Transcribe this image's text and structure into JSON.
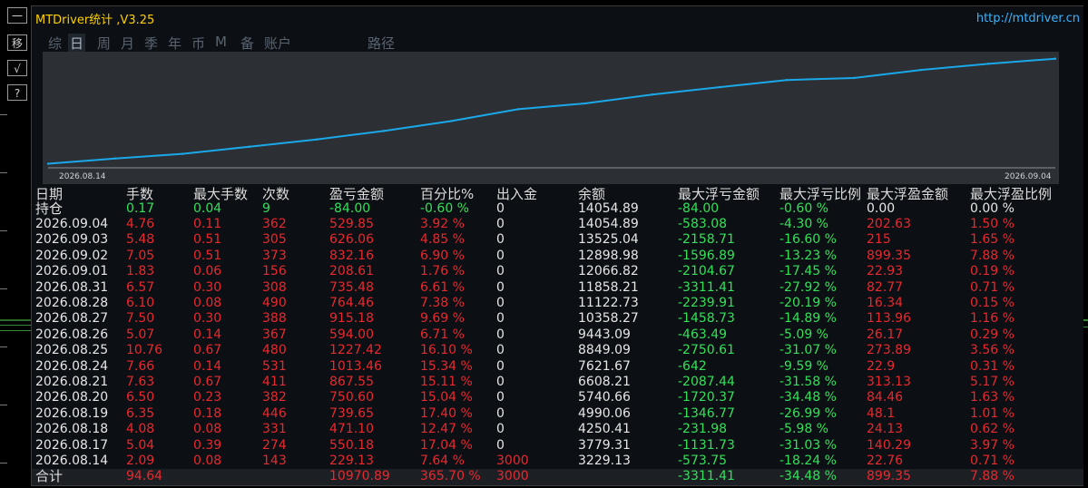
{
  "window": {
    "title": "MTDriver统计 ,V3.25",
    "url": "http://mtdriver.cn"
  },
  "left_buttons": [
    "一",
    "移",
    "√",
    "?"
  ],
  "tabs": [
    {
      "label": "综",
      "active": false
    },
    {
      "label": "日",
      "active": true
    },
    {
      "label": "周",
      "active": false
    },
    {
      "label": "月",
      "active": false
    },
    {
      "label": "季",
      "active": false
    },
    {
      "label": "年",
      "active": false
    },
    {
      "label": "币",
      "active": false
    },
    {
      "label": "M",
      "active": false
    },
    {
      "label": "备",
      "active": false
    },
    {
      "label": "账户",
      "active": false
    },
    {
      "label": "路径",
      "active": false
    }
  ],
  "chart_data": {
    "type": "line",
    "x_start_label": "2026.08.14",
    "x_end_label": "2026.09.04",
    "x": [
      "2026.08.14",
      "2026.08.17",
      "2026.08.18",
      "2026.08.19",
      "2026.08.20",
      "2026.08.21",
      "2026.08.24",
      "2026.08.25",
      "2026.08.26",
      "2026.08.27",
      "2026.08.28",
      "2026.08.31",
      "2026.09.01",
      "2026.09.02",
      "2026.09.03",
      "2026.09.04"
    ],
    "series": [
      {
        "values": [
          3229.13,
          3779.31,
          4250.41,
          4990.06,
          5740.66,
          6608.21,
          7621.67,
          8849.09,
          9443.09,
          10358.27,
          11122.73,
          11858.21,
          12066.82,
          12898.98,
          13525.04,
          14054.89
        ],
        "color": "#1aa8e8"
      }
    ],
    "ylim": [
      3000,
      14400
    ],
    "grid": false
  },
  "table": {
    "headers": [
      "日期",
      "手数",
      "最大手数",
      "次数",
      "盈亏金额",
      "百分比%",
      "出入金",
      "余额",
      "最大浮亏金额",
      "最大浮亏比例",
      "最大浮盈金额",
      "最大浮盈比例"
    ],
    "holding": {
      "label": "持仓",
      "cells": [
        "0.17",
        "0.04",
        "9",
        "-84.00",
        "-0.60 %",
        "0",
        "14054.89",
        "-84.00",
        "-0.60 %",
        "0.00",
        "0.00 %"
      ]
    },
    "rows": [
      [
        "2026.09.04",
        "4.76",
        "0.11",
        "362",
        "529.85",
        "3.92 %",
        "0",
        "14054.89",
        "-583.08",
        "-4.30 %",
        "202.63",
        "1.50 %"
      ],
      [
        "2026.09.03",
        "5.48",
        "0.51",
        "305",
        "626.06",
        "4.85 %",
        "0",
        "13525.04",
        "-2158.71",
        "-16.60 %",
        "215",
        "1.65 %"
      ],
      [
        "2026.09.02",
        "7.05",
        "0.51",
        "373",
        "832.16",
        "6.90 %",
        "0",
        "12898.98",
        "-1596.89",
        "-13.23 %",
        "899.35",
        "7.88 %"
      ],
      [
        "2026.09.01",
        "1.83",
        "0.06",
        "156",
        "208.61",
        "1.76 %",
        "0",
        "12066.82",
        "-2104.67",
        "-17.45 %",
        "22.93",
        "0.19 %"
      ],
      [
        "2026.08.31",
        "6.57",
        "0.30",
        "308",
        "735.48",
        "6.61 %",
        "0",
        "11858.21",
        "-3311.41",
        "-27.92 %",
        "82.77",
        "0.71 %"
      ],
      [
        "2026.08.28",
        "6.10",
        "0.08",
        "490",
        "764.46",
        "7.38 %",
        "0",
        "11122.73",
        "-2239.91",
        "-20.19 %",
        "16.34",
        "0.15 %"
      ],
      [
        "2026.08.27",
        "7.50",
        "0.30",
        "388",
        "915.18",
        "9.69 %",
        "0",
        "10358.27",
        "-1458.73",
        "-14.89 %",
        "113.96",
        "1.16 %"
      ],
      [
        "2026.08.26",
        "5.07",
        "0.14",
        "367",
        "594.00",
        "6.71 %",
        "0",
        "9443.09",
        "-463.49",
        "-5.09 %",
        "26.17",
        "0.29 %"
      ],
      [
        "2026.08.25",
        "10.76",
        "0.67",
        "480",
        "1227.42",
        "16.10 %",
        "0",
        "8849.09",
        "-2750.61",
        "-31.07 %",
        "273.89",
        "3.56 %"
      ],
      [
        "2026.08.24",
        "7.66",
        "0.14",
        "531",
        "1013.46",
        "15.34 %",
        "0",
        "7621.67",
        "-642",
        "-9.59 %",
        "22.9",
        "0.31 %"
      ],
      [
        "2026.08.21",
        "7.63",
        "0.67",
        "411",
        "867.55",
        "15.11 %",
        "0",
        "6608.21",
        "-2087.44",
        "-31.58 %",
        "313.13",
        "5.17 %"
      ],
      [
        "2026.08.20",
        "6.50",
        "0.23",
        "382",
        "750.60",
        "15.04 %",
        "0",
        "5740.66",
        "-1720.37",
        "-34.48 %",
        "84.46",
        "1.63 %"
      ],
      [
        "2026.08.19",
        "6.35",
        "0.18",
        "446",
        "739.65",
        "17.40 %",
        "0",
        "4990.06",
        "-1346.77",
        "-26.99 %",
        "48.1",
        "1.01 %"
      ],
      [
        "2026.08.18",
        "4.08",
        "0.08",
        "331",
        "471.10",
        "12.47 %",
        "0",
        "4250.41",
        "-231.98",
        "-5.98 %",
        "24.13",
        "0.62 %"
      ],
      [
        "2026.08.17",
        "5.04",
        "0.39",
        "274",
        "550.18",
        "17.04 %",
        "0",
        "3779.31",
        "-1131.73",
        "-31.03 %",
        "140.29",
        "3.97 %"
      ],
      [
        "2026.08.14",
        "2.09",
        "0.08",
        "143",
        "229.13",
        "7.64 %",
        "3000",
        "3229.13",
        "-573.75",
        "-18.24 %",
        "22.76",
        "0.71 %"
      ]
    ],
    "total": {
      "label": "合计",
      "lots": "94.64",
      "pnl": "10970.89",
      "pct": "365.70 %",
      "deposit": "3000",
      "max_float_loss": "-3311.41",
      "max_float_loss_pct": "-34.48 %",
      "max_float_profit": "899.35",
      "max_float_profit_pct": "7.88 %"
    }
  },
  "colors": {
    "title": "#ffd000",
    "url": "#3ab4ff",
    "profit": "#e8292e",
    "loss": "#33e05a",
    "line": "#1aa8e8"
  }
}
